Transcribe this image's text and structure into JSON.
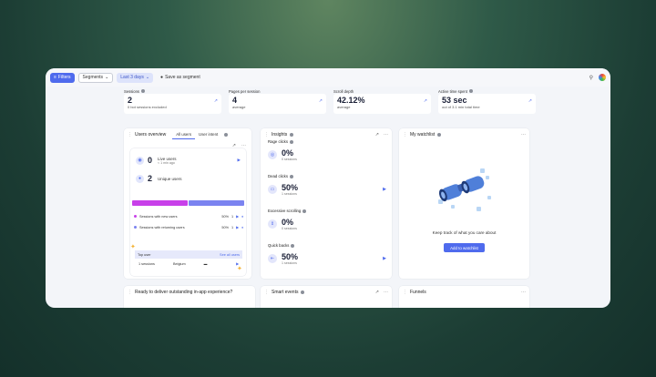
{
  "toolbar": {
    "filters": "Filters",
    "segments": "Segments",
    "date": "Last 3 days",
    "save": "Save as segment"
  },
  "stats": [
    {
      "label": "Sessions",
      "value": "2",
      "sub": "0 bot sessions excluded"
    },
    {
      "label": "Pages per session",
      "value": "4",
      "sub": "average"
    },
    {
      "label": "Scroll depth",
      "value": "42.12%",
      "sub": "average"
    },
    {
      "label": "Active time spent",
      "value": "53 sec",
      "sub": "out of 3.1 min total time"
    }
  ],
  "users_overview": {
    "title": "Users overview",
    "tabs": [
      "All users",
      "User intent"
    ],
    "live_value": "0",
    "live_label": "Live users",
    "live_sub": "< 1 min ago",
    "unique_value": "2",
    "unique_label": "Unique users",
    "segments": [
      {
        "label": "Sessions with new users",
        "pct": "50%",
        "count": "1",
        "color": "#c840e9"
      },
      {
        "label": "Sessions with returning users",
        "pct": "50%",
        "count": "1",
        "color": "#7b83f0"
      }
    ],
    "top_user_label": "Top user",
    "see_all": "See all users",
    "top_user_sessions": "1 sessions",
    "top_user_country": "Belgium"
  },
  "insights": {
    "title": "Insights",
    "items": [
      {
        "label": "Rage clicks",
        "value": "0%",
        "sub": "0 sessions"
      },
      {
        "label": "Dead clicks",
        "value": "50%",
        "sub": "1 sessions"
      },
      {
        "label": "Excessive scrolling",
        "value": "0%",
        "sub": "0 sessions"
      },
      {
        "label": "Quick backs",
        "value": "50%",
        "sub": "1 sessions"
      }
    ]
  },
  "watchlist": {
    "title": "My watchlist",
    "message": "Keep track of what you care about",
    "button": "Add to watchlist"
  },
  "bottom": {
    "promo": "Ready to deliver outstanding in-app experience?",
    "smart_events": "Smart events",
    "funnels": "Funnels"
  },
  "colors": {
    "accent": "#4f6bed",
    "new_users": "#c840e9",
    "returning_users": "#7b83f0"
  }
}
